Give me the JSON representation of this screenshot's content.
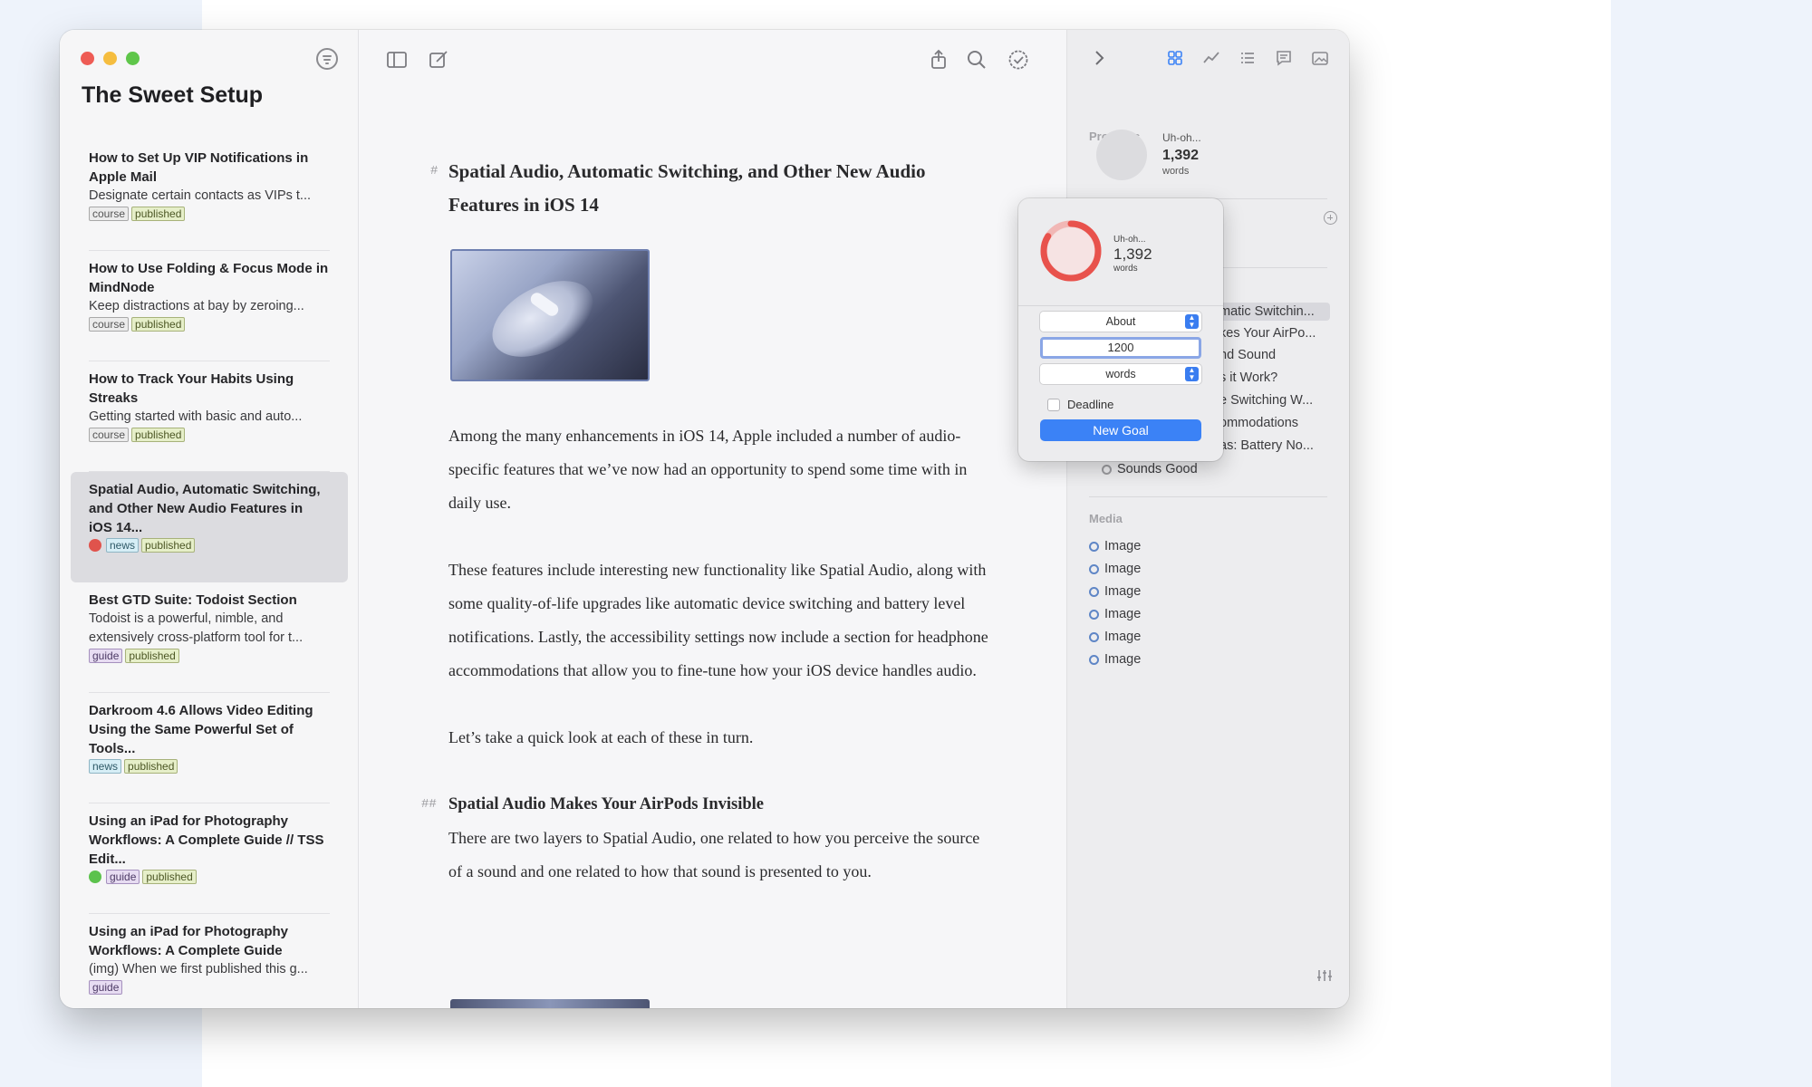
{
  "library": {
    "title": "The Sweet Setup",
    "sheets": [
      {
        "title": "How to Set Up VIP Notifications in Apple Mail",
        "excerpt": "Designate certain contacts as VIPs t...",
        "tags": [
          "course",
          "published"
        ]
      },
      {
        "title": "How to Use Folding & Focus Mode in MindNode",
        "excerpt": "Keep distractions at bay by zeroing...",
        "tags": [
          "course",
          "published"
        ]
      },
      {
        "title": "How to Track Your Habits Using Streaks",
        "excerpt": "Getting started with basic and auto...",
        "tags": [
          "course",
          "published"
        ]
      },
      {
        "title": "Spatial Audio, Automatic Switching, and Other New Audio Features in iOS 14...",
        "excerpt": "",
        "tags": [
          "news",
          "published"
        ],
        "dot_color": "#e0534c"
      },
      {
        "title": "Best GTD Suite: Todoist Section",
        "excerpt": "Todoist is a powerful, nimble, and extensively cross-platform tool for t...",
        "tags": [
          "guide",
          "published"
        ]
      },
      {
        "title": "Darkroom 4.6 Allows Video Editing Using the Same Powerful Set of Tools...",
        "excerpt": "",
        "tags": [
          "news",
          "published"
        ]
      },
      {
        "title": "Using an iPad for Photography Workflows: A Complete Guide // TSS Edit...",
        "excerpt": "",
        "tags": [
          "guide",
          "published"
        ],
        "dot_color": "#5cc24d"
      },
      {
        "title": "Using an iPad for Photography Workflows: A Complete Guide",
        "excerpt": "(img) When we first published this g...",
        "tags": [
          "guide"
        ]
      }
    ]
  },
  "editor": {
    "h1_marker": "#",
    "h2_marker": "##",
    "title": "Spatial Audio, Automatic Switching, and Other New Audio Features in iOS 14",
    "paragraphs": [
      "Among the many enhancements in iOS 14, Apple included a number of audio-specific features that we’ve now had an opportunity to spend some time with in daily use.",
      "These features include interesting new functionality like Spatial Audio, along with some quality-of-life upgrades like automatic device switching and battery level notifications. Lastly, the accessibility settings now include a section for headphone accommodations that allow you to fine-tune how your iOS device handles audio.",
      "Let’s take a quick look at each  of these in turn."
    ],
    "subheading": "Spatial Audio Makes Your AirPods Invisible",
    "subparagraph": "There are two layers to Spatial Audio, one related to how you perceive the source of a sound and one related to how that sound is presented to you."
  },
  "inspector": {
    "progress_label": "Progress",
    "progress_status": "Uh-oh...",
    "word_count": "1,392",
    "word_unit": "words",
    "outline": [
      "matic Switchin...",
      "kes Your AirPo...",
      "nd Sound",
      "s it Work?",
      "e Switching W...",
      "ommodations",
      "as: Battery No...",
      "Sounds Good"
    ],
    "media_label": "Media",
    "media": [
      "Image",
      "Image",
      "Image",
      "Image",
      "Image",
      "Image"
    ]
  },
  "goal_popover": {
    "status": "Uh-oh...",
    "word_count": "1,392",
    "word_unit": "words",
    "mode": "About",
    "target": "1200",
    "unit": "words",
    "deadline_label": "Deadline",
    "deadline_checked": false,
    "button": "New Goal",
    "progress_fraction": 0.84
  }
}
